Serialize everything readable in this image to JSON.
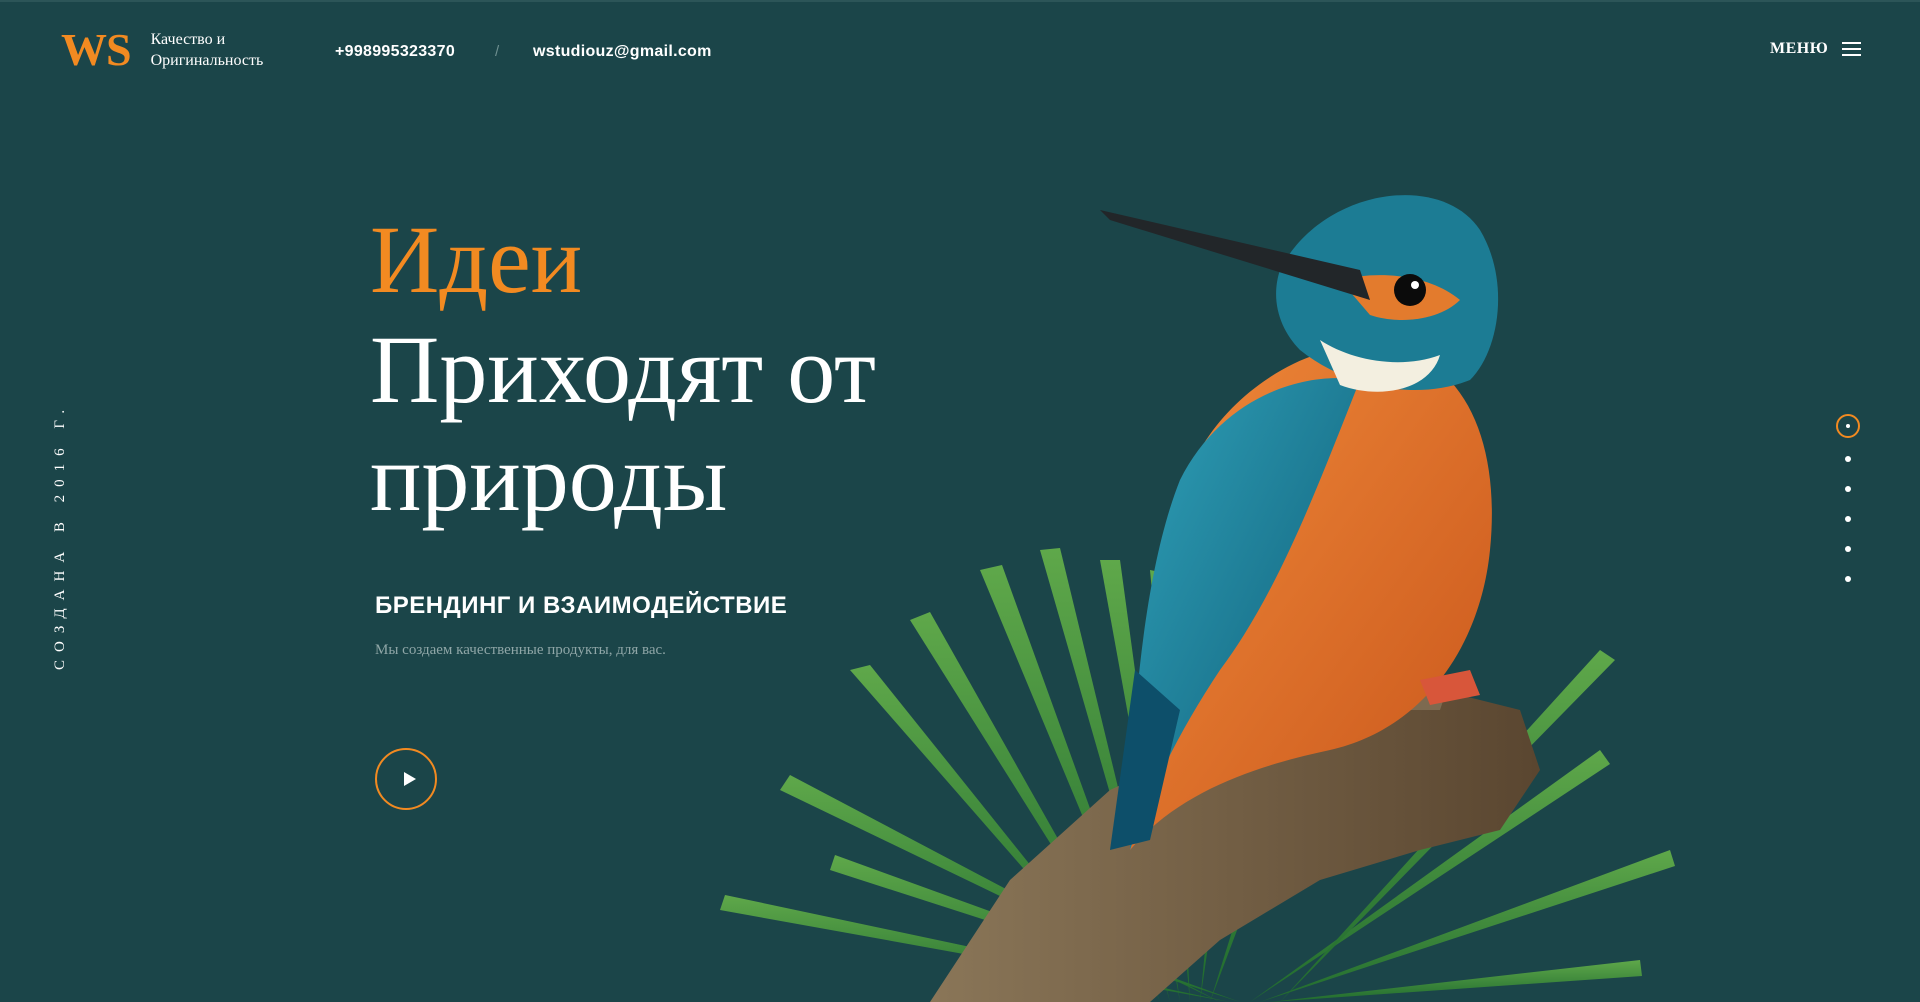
{
  "header": {
    "logo_mark": "WS",
    "tagline_line1": "Качество и",
    "tagline_line2": "Оригинальность",
    "phone": "+998995323370",
    "separator": "/",
    "email": "wstudiouz@gmail.com",
    "menu_label": "МЕНЮ",
    "menu_icon": "hamburger-icon"
  },
  "side": {
    "founded": "СОЗДАНА В 2016 Г."
  },
  "hero": {
    "accent": "Идеи",
    "line2": "Приходят от",
    "line3": "природы",
    "subtitle": "БРЕНДИНГ И ВЗАИМОДЕЙСТВИЕ",
    "description": "Мы создаем качественные продукты, для вас.",
    "play_icon": "play-icon"
  },
  "pager": {
    "count": 6,
    "active": 1
  },
  "colors": {
    "background": "#1b4549",
    "accent": "#f28a21",
    "text": "#ffffff",
    "muted": "#8fa6a7"
  }
}
